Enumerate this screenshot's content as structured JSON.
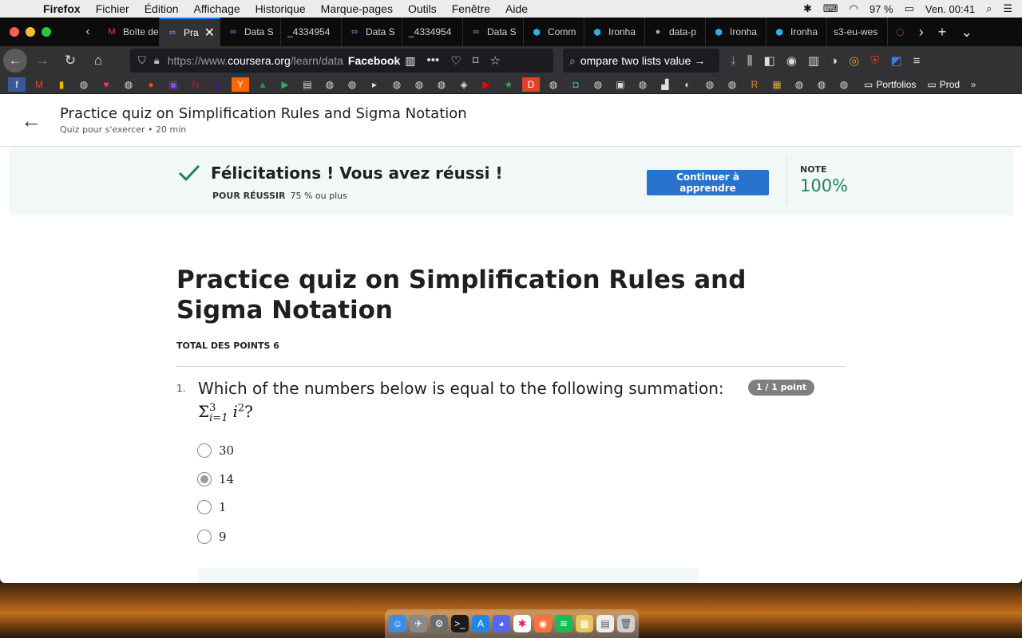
{
  "menubar": {
    "items": [
      "Firefox",
      "Fichier",
      "Édition",
      "Affichage",
      "Historique",
      "Marque-pages",
      "Outils",
      "Fenêtre",
      "Aide"
    ],
    "battery": "97 %",
    "clock": "Ven. 00:41"
  },
  "tabs": [
    {
      "label": "Boîte de",
      "icon": "gmail-icon"
    },
    {
      "label": "Pra",
      "icon": "coursera-icon",
      "active": true
    },
    {
      "label": "Data S",
      "icon": "coursera-icon"
    },
    {
      "label": "_4334954",
      "icon": "blank-icon"
    },
    {
      "label": "Data S",
      "icon": "coursera-icon"
    },
    {
      "label": "_4334954",
      "icon": "blank-icon"
    },
    {
      "label": "Data S",
      "icon": "coursera-icon"
    },
    {
      "label": "Comm",
      "icon": "hexagon-icon"
    },
    {
      "label": "Ironha",
      "icon": "ironhack-icon"
    },
    {
      "label": "data-p",
      "icon": "github-icon"
    },
    {
      "label": "Ironha",
      "icon": "ironhack-icon"
    },
    {
      "label": "Ironha",
      "icon": "ironhack-icon"
    },
    {
      "label": "s3-eu-wes",
      "icon": "blank-icon"
    }
  ],
  "navbar": {
    "url_prefix": "https://www.",
    "url_domain": "coursera.org",
    "url_suffix": "/learn/data",
    "facebook_label": "Facebook",
    "search_value": "ompare two lists value"
  },
  "bookmarks": {
    "folder1": "Portfolios",
    "folder2": "Prod"
  },
  "page_header": {
    "title": "Practice quiz on Simplification Rules and Sigma Notation",
    "subtitle": "Quiz pour s'exercer • 20  min"
  },
  "banner": {
    "congrats": "Félicitations ! Vous avez réussi !",
    "pass_label": "POUR RÉUSSIR",
    "pass_value": "75 % ou plus",
    "continue_button": "Continuer à apprendre",
    "note_label": "NOTE",
    "note_value": "100%",
    "accent_color": "#1f8354"
  },
  "quiz": {
    "title": "Practice quiz on Simplification Rules and Sigma Notation",
    "total_points": "TOTAL DES POINTS 6",
    "question": {
      "number": "1.",
      "text": "Which of the numbers below is equal to the following summation:",
      "math_sigma": "Σ",
      "math_upper": "3",
      "math_lower": "i=1",
      "math_term": "i",
      "math_power": "2",
      "math_end": "?",
      "points": "1 / 1 point",
      "options": [
        {
          "label": "30",
          "selected": false
        },
        {
          "label": "14",
          "selected": true
        },
        {
          "label": "1",
          "selected": false
        },
        {
          "label": "9",
          "selected": false
        }
      ]
    }
  }
}
